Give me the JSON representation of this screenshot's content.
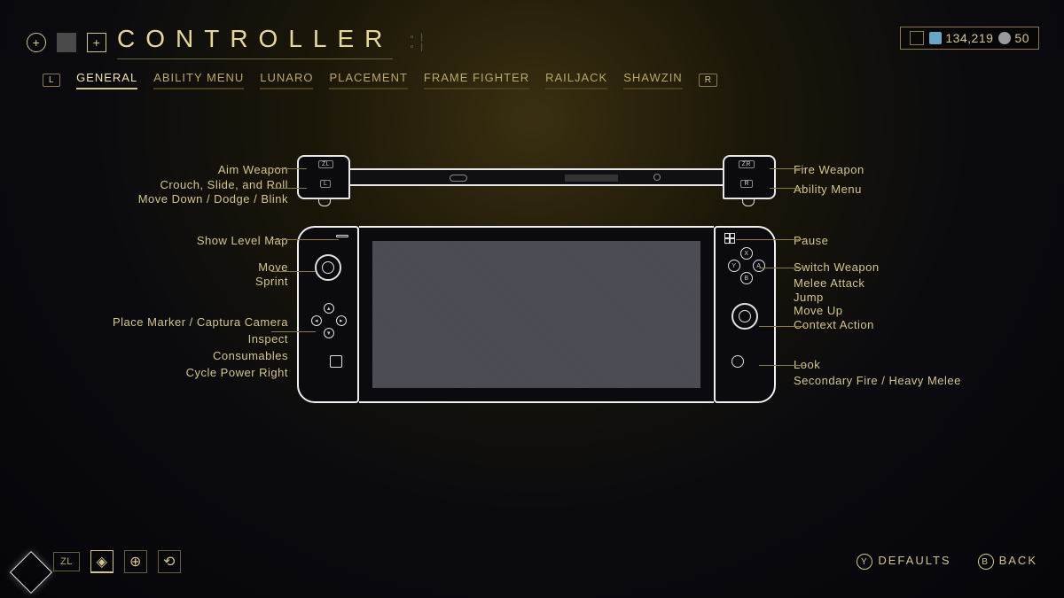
{
  "header": {
    "title": "CONTROLLER"
  },
  "currency": {
    "credits": "134,219",
    "platinum": "50"
  },
  "tabs": {
    "prev_hint": "L",
    "next_hint": "R",
    "items": [
      {
        "label": "GENERAL",
        "active": true
      },
      {
        "label": "ABILITY MENU"
      },
      {
        "label": "LUNARO"
      },
      {
        "label": "PLACEMENT"
      },
      {
        "label": "FRAME FIGHTER"
      },
      {
        "label": "RAILJACK"
      },
      {
        "label": "SHAWZIN"
      }
    ]
  },
  "bindings_left": {
    "zl": "Aim Weapon",
    "l_top": "Crouch, Slide, and Roll",
    "l_bot": "Move Down / Dodge / Blink",
    "minus": "Show Level Map",
    "lstick_move": "Move",
    "lstick_press": "Sprint",
    "dpad_up": "Place Marker / Captura Camera",
    "dpad_right": "Inspect",
    "dpad_down": "Consumables",
    "dpad_left": "Cycle Power Right"
  },
  "bindings_right": {
    "zr": "Fire Weapon",
    "r": "Ability Menu",
    "plus": "Pause",
    "x": "Switch Weapon",
    "a": "Melee Attack",
    "b_top": "Jump",
    "b_bot": "Move Up",
    "y": "Context Action",
    "rstick_move": "Look",
    "rstick_press": "Secondary Fire / Heavy Melee"
  },
  "button_labels": {
    "zl": "ZL",
    "l": "L",
    "zr": "ZR",
    "r": "R",
    "x": "X",
    "y": "Y",
    "a": "A",
    "b": "B"
  },
  "footer": {
    "zl_hint": "ZL",
    "defaults_btn": "Y",
    "defaults_label": "DEFAULTS",
    "back_btn": "B",
    "back_label": "BACK"
  }
}
